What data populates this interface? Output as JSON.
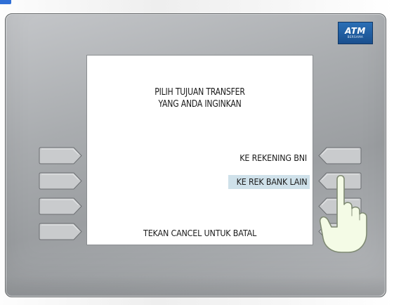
{
  "logo": {
    "main": "ATM",
    "sub": "BERSAMA"
  },
  "screen": {
    "title_line1": "PILIH TUJUAN TRANSFER",
    "title_line2": "YANG ANDA INGINKAN",
    "options": [
      {
        "label": "KE REKENING BNI",
        "selected": false
      },
      {
        "label": "KE REK BANK LAIN",
        "selected": true
      }
    ],
    "footer": "TEKAN CANCEL UNTUK BATAL"
  },
  "side_keys": {
    "left_count": 4,
    "right_count": 4
  },
  "colors": {
    "panel": "#a9acaf",
    "screen": "#ffffff",
    "selection_highlight": "#cfe1ea",
    "logo_blue": "#2a6fb6",
    "hand_fill": "#f4fbe6",
    "hand_outline": "#7f8a73"
  },
  "icons": {
    "pointer": "pointing-hand-icon",
    "logo": "atm-bersama-logo"
  }
}
